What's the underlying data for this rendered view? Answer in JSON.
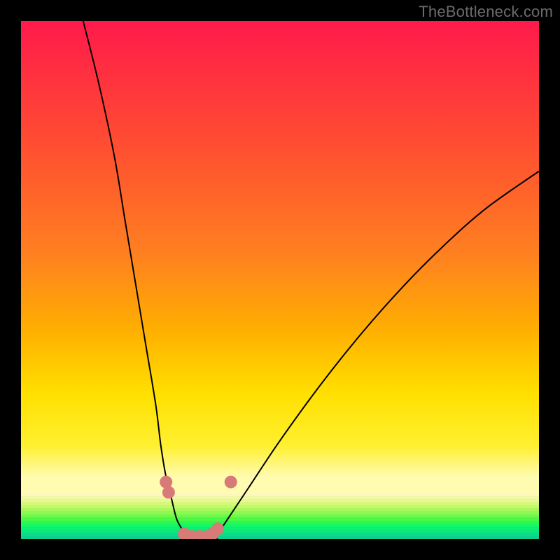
{
  "watermark": "TheBottleneck.com",
  "chart_data": {
    "type": "line",
    "title": "",
    "xlabel": "",
    "ylabel": "",
    "xlim": [
      0,
      100
    ],
    "ylim": [
      0,
      100
    ],
    "note": "Axes are unlabeled; values are estimated positions in percent of the plot area (0 at bottom-left).",
    "series": [
      {
        "name": "left-branch",
        "x": [
          12,
          15,
          18,
          20,
          22,
          24,
          26,
          27,
          28,
          29,
          30,
          31,
          32
        ],
        "y": [
          100,
          88,
          74,
          62,
          50,
          38,
          26,
          18,
          12,
          8,
          4,
          2,
          0
        ]
      },
      {
        "name": "valley-floor",
        "x": [
          32,
          33,
          34,
          35,
          36,
          37,
          38
        ],
        "y": [
          0,
          0,
          0,
          0,
          0,
          0,
          0
        ]
      },
      {
        "name": "right-branch",
        "x": [
          38,
          40,
          44,
          50,
          58,
          66,
          74,
          82,
          90,
          100
        ],
        "y": [
          1,
          4,
          10,
          19,
          30,
          40,
          49,
          57,
          64,
          71
        ]
      }
    ],
    "markers": [
      {
        "name": "left-marker-1",
        "x": 28.0,
        "y": 11.0
      },
      {
        "name": "left-marker-2",
        "x": 28.5,
        "y": 9.0
      },
      {
        "name": "floor-marker-1",
        "x": 31.5,
        "y": 1.0
      },
      {
        "name": "floor-marker-2",
        "x": 33.0,
        "y": 0.5
      },
      {
        "name": "floor-marker-3",
        "x": 34.5,
        "y": 0.5
      },
      {
        "name": "floor-marker-4",
        "x": 36.0,
        "y": 0.5
      },
      {
        "name": "floor-marker-5",
        "x": 37.0,
        "y": 1.0
      },
      {
        "name": "floor-marker-6",
        "x": 38.0,
        "y": 2.0
      },
      {
        "name": "right-marker-1",
        "x": 40.5,
        "y": 11.0
      }
    ],
    "background_gradient_stops": [
      {
        "pos": 0,
        "color": "#ff1a4b"
      },
      {
        "pos": 25,
        "color": "#ff5030"
      },
      {
        "pos": 60,
        "color": "#ffb000"
      },
      {
        "pos": 82,
        "color": "#fff030"
      },
      {
        "pos": 88,
        "color": "#fffbb0"
      },
      {
        "pos": 100,
        "color": "#00ff66"
      }
    ],
    "green_band_colors": [
      "#fcf8c0",
      "#f2f7a8",
      "#e6f890",
      "#d6f87a",
      "#c2f86a",
      "#a8f85c",
      "#8cf852",
      "#6ef84a",
      "#4cf846",
      "#2cf850",
      "#18f860",
      "#0cf070",
      "#0ce87c",
      "#0cdc88",
      "#0cd090"
    ]
  }
}
